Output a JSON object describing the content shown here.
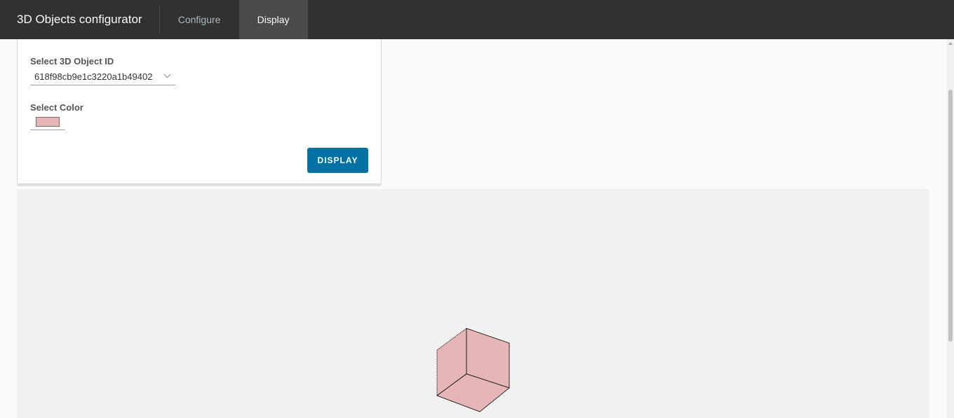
{
  "header": {
    "title": "3D Objects configurator",
    "tabs": [
      {
        "label": "Configure",
        "active": false
      },
      {
        "label": "Display",
        "active": true
      }
    ]
  },
  "form": {
    "object_id_label": "Select 3D Object ID",
    "object_id_value": "618f98cb9e1c3220a1b49402",
    "color_label": "Select Color",
    "color_value": "#e6b5b5",
    "display_button": "DISPLAY"
  },
  "viewer": {
    "object": "cube",
    "face_color": "#e6b5b5",
    "edge_color": "#000000"
  },
  "colors": {
    "header_bg": "#313131",
    "accent": "#0072a3",
    "viewer_bg": "#f1f1f1"
  }
}
